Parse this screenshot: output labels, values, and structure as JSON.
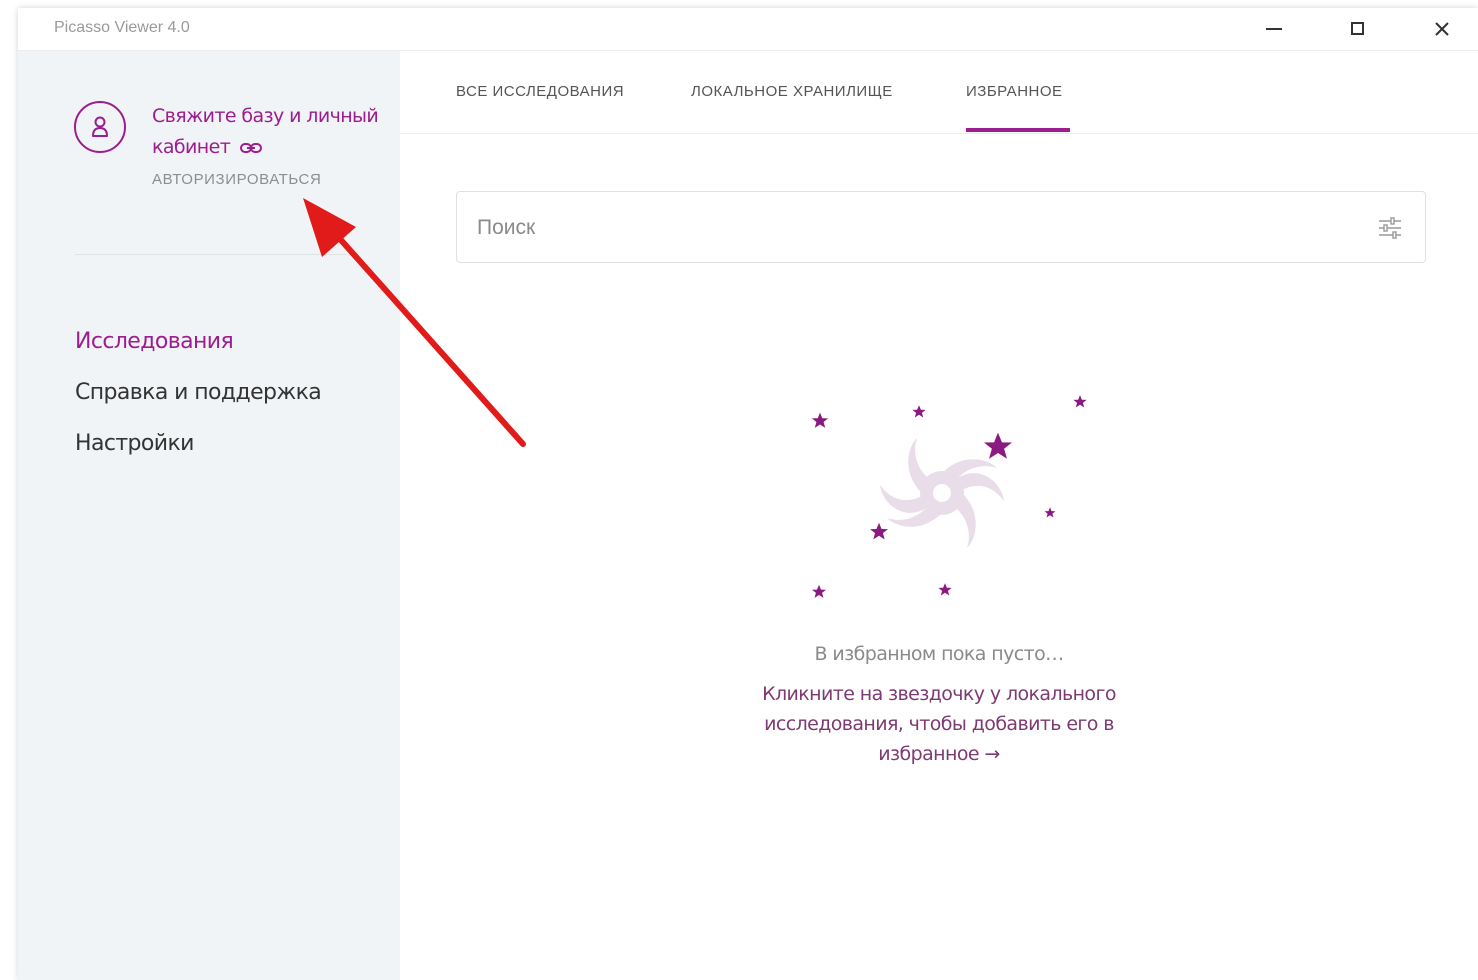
{
  "window": {
    "title": "Picasso Viewer 4.0"
  },
  "sidebar": {
    "link_title": "Свяжите базу и личный кабинет",
    "auth_label": "АВТОРИЗИРОВАТЬСЯ",
    "items": [
      {
        "label": "Исследования",
        "active": true
      },
      {
        "label": "Справка и поддержка",
        "active": false
      },
      {
        "label": "Настройки",
        "active": false
      }
    ]
  },
  "tabs": [
    {
      "label": "ВСЕ ИССЛЕДОВАНИЯ",
      "active": false
    },
    {
      "label": "ЛОКАЛЬНОЕ ХРАНИЛИЩЕ",
      "active": false
    },
    {
      "label": "ИЗБРАННОЕ",
      "active": true
    }
  ],
  "search": {
    "placeholder": "Поиск",
    "value": ""
  },
  "empty_state": {
    "title": "В избранном пока пусто…",
    "hint": "Кликните на звездочку у локального исследования, чтобы добавить его в избранное →"
  },
  "colors": {
    "accent": "#9c1d8e",
    "sidebar_bg": "#f1f4f6",
    "annotation_arrow": "#e11a1a"
  },
  "icons": {
    "minimize": "minimize-icon",
    "maximize": "maximize-icon",
    "close": "close-icon",
    "user": "user-icon",
    "link": "link-icon",
    "filter": "filter-icon"
  }
}
